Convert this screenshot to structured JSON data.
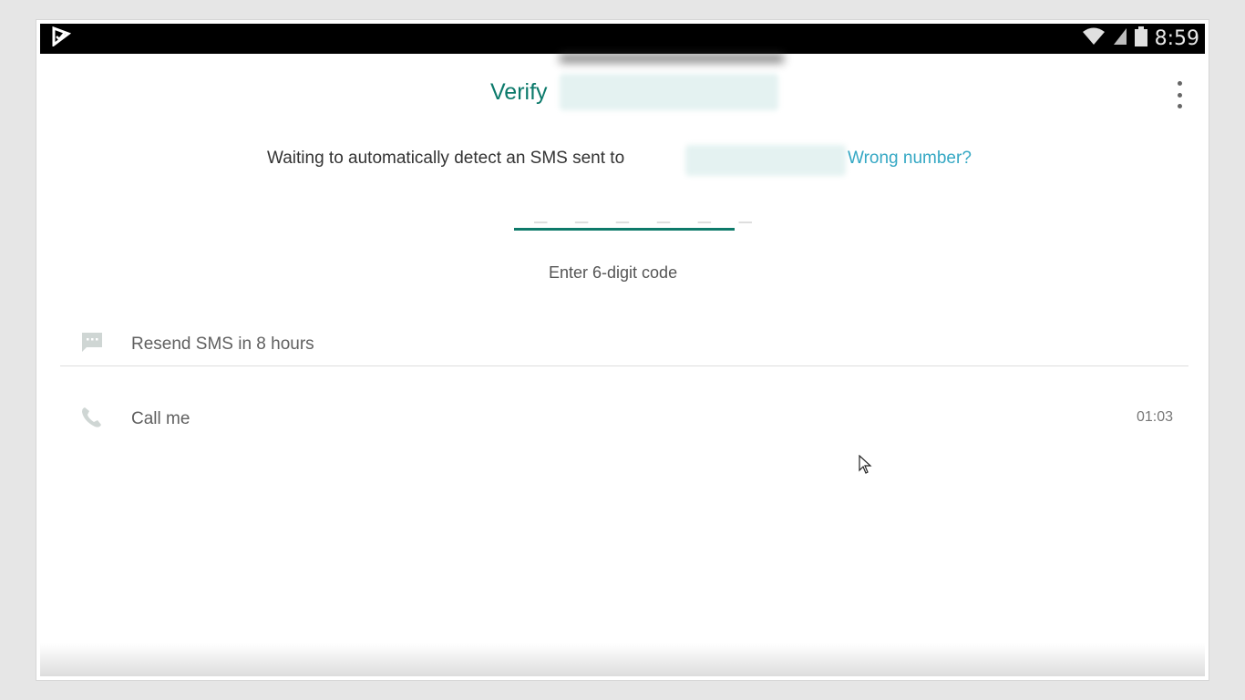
{
  "status_bar": {
    "time": "8:59",
    "icons": [
      "notification-icon",
      "wifi-icon",
      "signal-icon",
      "battery-icon"
    ]
  },
  "header": {
    "title": "Verify",
    "menu_icon": "more-vert-icon"
  },
  "verification": {
    "waiting_text": "Waiting to automatically detect an SMS sent to",
    "wrong_number_link": "Wrong number?",
    "code_placeholder": "_ _ _  _ _ _",
    "code_hint": "Enter 6-digit code"
  },
  "options": {
    "resend": {
      "label": "Resend SMS in 8 hours",
      "icon": "message-icon"
    },
    "call": {
      "label": "Call me",
      "timer": "01:03",
      "icon": "phone-icon"
    }
  },
  "colors": {
    "accent": "#0c7a6b",
    "link": "#35a8c4",
    "status_bar": "#000000"
  }
}
